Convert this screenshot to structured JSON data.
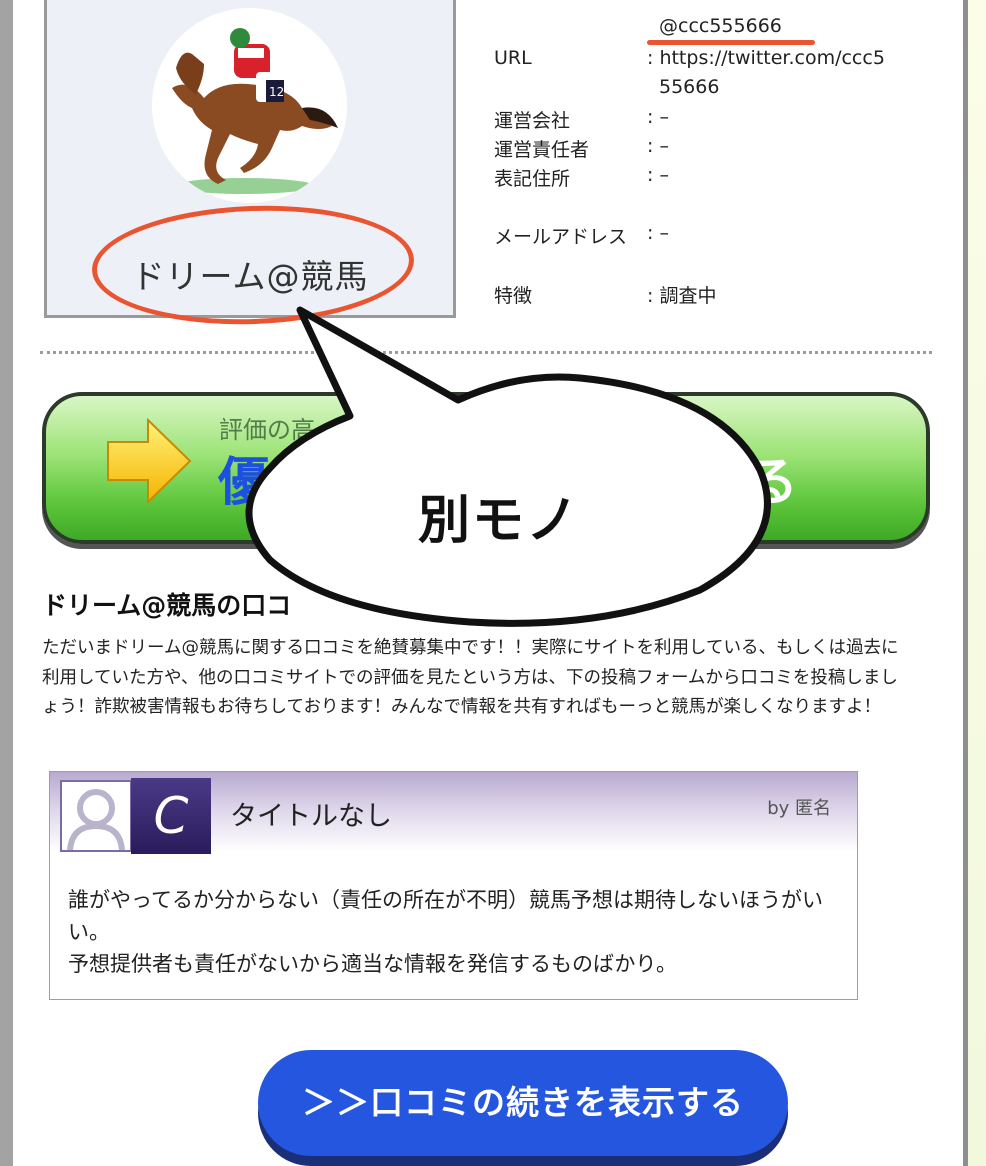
{
  "profile": {
    "name": "ドリーム@競馬",
    "avatar_icon": "racehorse-jockey-icon"
  },
  "info": {
    "handle": "@ccc555666",
    "rows": [
      {
        "label": "URL",
        "value": ": https://twitter.com/ccc5"
      },
      {
        "label": "",
        "value": "55666"
      },
      {
        "label": "運営会社",
        "value": ": –"
      },
      {
        "label": "運営責任者",
        "value": ": –"
      },
      {
        "label": "表記住所",
        "value": ": –"
      },
      {
        "label": "メールアドレス",
        "value": ": –"
      },
      {
        "label": "特徴",
        "value": ": 調査中"
      }
    ]
  },
  "banner": {
    "small_text": "評価の高",
    "big_left": "優",
    "big_right": "る",
    "arrow_icon": "yellow-arrow-right-icon"
  },
  "callout": {
    "text": "別モノ"
  },
  "section": {
    "title": "ドリーム@競馬の口コ",
    "intro": "ただいまドリーム@競馬に関する口コミを絶賛募集中です！！実際にサイトを利用している、もしくは過去に利用していた方や、他の口コミサイトでの評価を見たという方は、下の投稿フォームから口コミを投稿しましょう！詐欺被害情報もお待ちしております！みんなで情報を共有すればもーっと競馬が楽しくなりますよ！"
  },
  "review": {
    "grade": "C",
    "title": "タイトルなし",
    "by": "by 匿名",
    "body_line1": "誰がやってるか分からない（責任の所在が不明）競馬予想は期待しないほうがいい。",
    "body_line2": "予想提供者も責任がないから適当な情報を発信するものばかり。"
  },
  "more_button": {
    "label": "＞＞口コミの続きを表示する"
  },
  "colors": {
    "annotation_red": "#ea5531",
    "button_blue": "#2456df",
    "banner_green": "#5cc53a",
    "grade_purple": "#2a1b5c"
  }
}
